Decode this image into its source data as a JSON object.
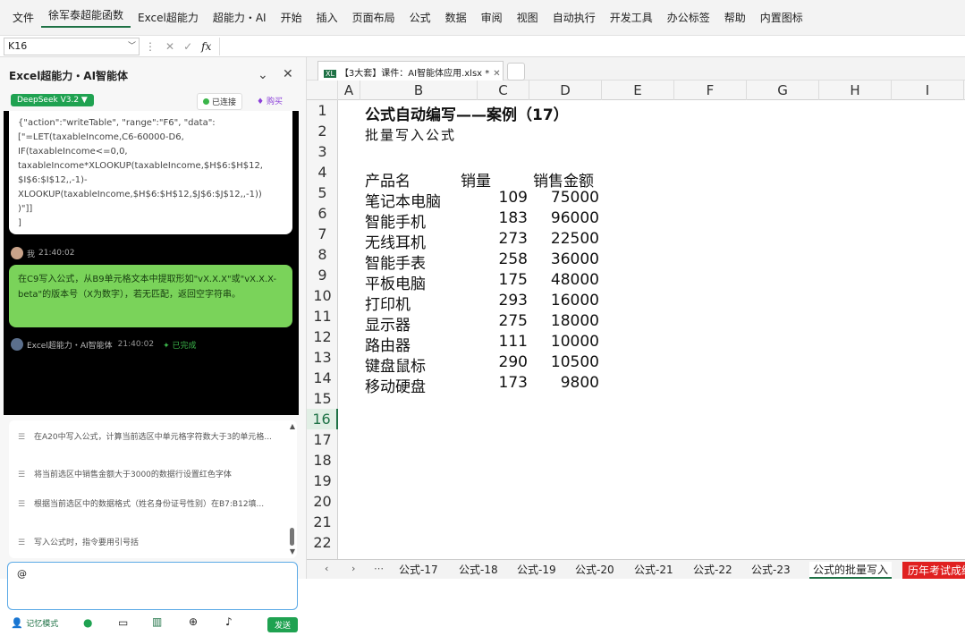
{
  "menu": [
    "文件",
    "徐军泰超能函数",
    "Excel超能力",
    "超能力・AI",
    "开始",
    "插入",
    "页面布局",
    "公式",
    "数据",
    "审阅",
    "视图",
    "自动执行",
    "开发工具",
    "办公标签",
    "帮助",
    "内置图标"
  ],
  "formula_bar": {
    "name_box": "K16",
    "cancel": "✕",
    "confirm": "✓",
    "fx": "fx",
    "value": ""
  },
  "panel": {
    "title": "Excel超能力・AI智能体",
    "model": "DeepSeek V3.2 ▼",
    "connected": "已连接",
    "buy": "购买",
    "code_lines": [
      "{\"action\":\"writeTable\", \"range\":\"F6\", \"data\":",
      "[\"=LET(taxableIncome,C6-60000-D6,",
      "IF(taxableIncome<=0,0,",
      "taxableIncome*XLOOKUP(taxableIncome,$H$6:$H$12,",
      "$I$6:$I$12,,-1)-",
      "XLOOKUP(taxableIncome,$H$6:$H$12,$J$6:$J$12,,-1))",
      ")\"]]",
      "]"
    ],
    "user_name": "我",
    "user_time": "21:40:02",
    "user_msg": "在C9写入公式，从B9单元格文本中提取形如\"vX.X.X\"或\"vX.X.X-beta\"的版本号（X为数字），若无匹配，返回空字符串。",
    "ai_name": "Excel超能力・AI智能体",
    "ai_time": "21:40:02",
    "ai_status": "已完成",
    "suggestions": [
      "在A20中写入公式，计算当前选区中单元格字符数大于3的单元格...",
      "将当前选区中销售金额大于3000的数据行设置红色字体",
      "根据当前选区中的数据格式（姓名身份证号性别）在B7:B12填...",
      "写入公式时，指令要用引号括"
    ],
    "input_value": "@",
    "bottom_label": "记忆模式",
    "send": "发送"
  },
  "file_tab": {
    "icon": "XL",
    "label": "【3大套】课件：AI智能体应用.xlsx *",
    "close": "✕"
  },
  "columns": [
    "A",
    "B",
    "C",
    "D",
    "E",
    "F",
    "G",
    "H",
    "I"
  ],
  "rows": [
    "1",
    "2",
    "3",
    "4",
    "5",
    "6",
    "7",
    "8",
    "9",
    "10",
    "11",
    "12",
    "13",
    "14",
    "15",
    "16",
    "17",
    "18",
    "19",
    "20",
    "21",
    "22"
  ],
  "selected_row": "16",
  "sheet": {
    "title": "公式自动编写——案例（17）",
    "subtitle": "批量写入公式",
    "headers": [
      "产品名",
      "销量",
      "销售金额"
    ],
    "data": [
      [
        "笔记本电脑",
        "109",
        "75000"
      ],
      [
        "智能手机",
        "183",
        "96000"
      ],
      [
        "无线耳机",
        "273",
        "22500"
      ],
      [
        "智能手表",
        "258",
        "36000"
      ],
      [
        "平板电脑",
        "175",
        "48000"
      ],
      [
        "打印机",
        "293",
        "16000"
      ],
      [
        "显示器",
        "275",
        "18000"
      ],
      [
        "路由器",
        "111",
        "10000"
      ],
      [
        "键盘鼠标",
        "290",
        "10500"
      ],
      [
        "移动硬盘",
        "173",
        "9800"
      ]
    ]
  },
  "sheet_tabs": [
    "公式-17",
    "公式-18",
    "公式-19",
    "公式-20",
    "公式-21",
    "公式-22",
    "公式-23",
    "公式的批量写入",
    "历年考试成绩"
  ],
  "active_sheet": "公式的批量写入"
}
